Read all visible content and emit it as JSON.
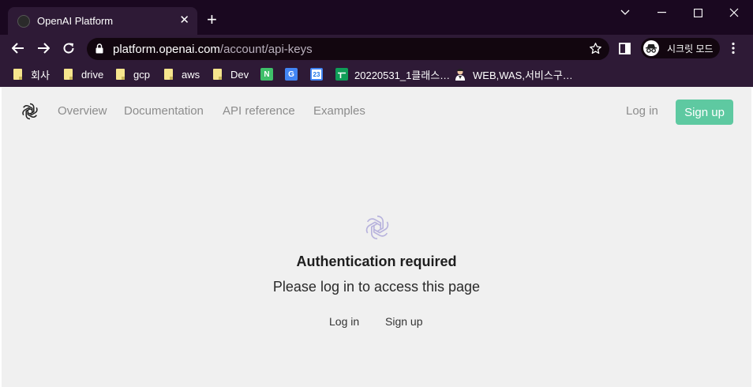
{
  "browser": {
    "tab_title": "OpenAI Platform",
    "url_host": "platform.openai.com",
    "url_path": "/account/api-keys",
    "incognito_label": "시크릿 모드",
    "bookmarks": [
      {
        "label": "회사",
        "icon": "folder-icon"
      },
      {
        "label": "drive",
        "icon": "folder-icon"
      },
      {
        "label": "gcp",
        "icon": "folder-icon"
      },
      {
        "label": "aws",
        "icon": "folder-icon"
      },
      {
        "label": "Dev",
        "icon": "folder-icon"
      },
      {
        "label": "",
        "icon": "notion-style-icon"
      },
      {
        "label": "",
        "icon": "google-translate-icon"
      },
      {
        "label": "",
        "icon": "calendar-icon"
      },
      {
        "label": "20220531_1클래스…",
        "icon": "sheets-icon"
      },
      {
        "label": "WEB,WAS,서비스구…",
        "icon": "person-icon"
      }
    ]
  },
  "site": {
    "nav": {
      "overview": "Overview",
      "documentation": "Documentation",
      "api_reference": "API reference",
      "examples": "Examples"
    },
    "login_label": "Log in",
    "signup_label": "Sign up"
  },
  "auth": {
    "title": "Authentication required",
    "message": "Please log in to access this page",
    "login_label": "Log in",
    "signup_label": "Sign up"
  },
  "colors": {
    "chrome_bg": "#2e1a36",
    "titlebar_bg": "#1a0820",
    "accent_green": "#5ec9a1",
    "page_bg": "#f0f0f0"
  }
}
